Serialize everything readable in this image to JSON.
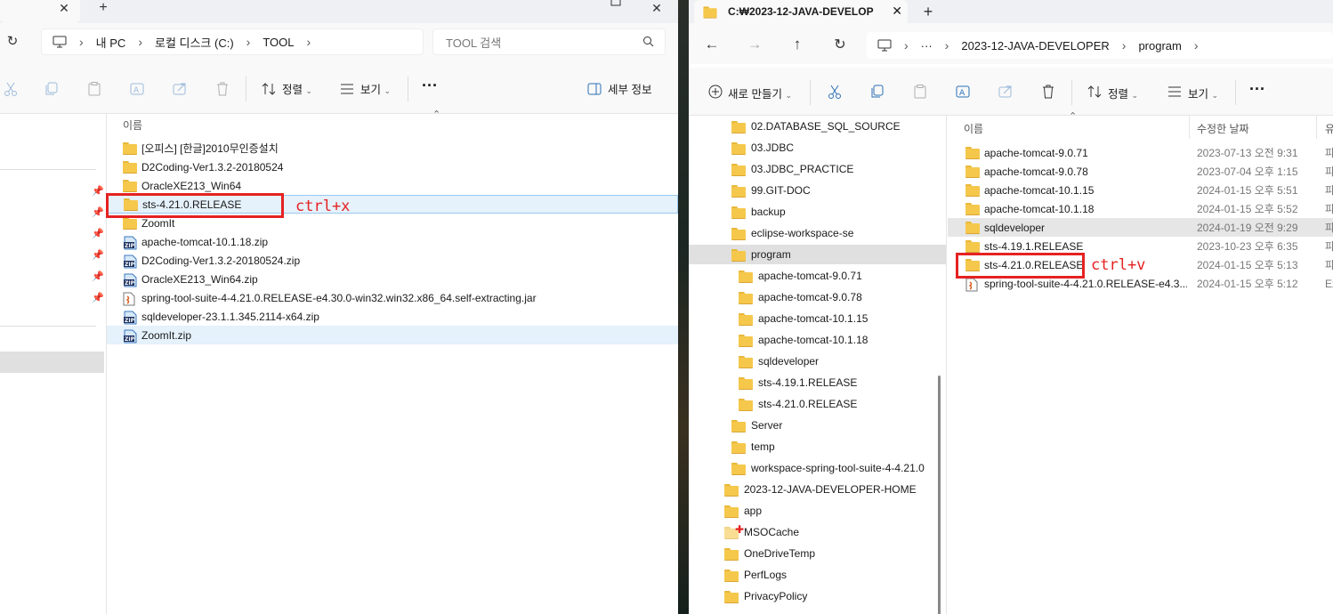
{
  "left": {
    "breadcrumb": [
      "내 PC",
      "로컬 디스크 (C:)",
      "TOOL"
    ],
    "search_placeholder": "TOOL 검색",
    "toolbar": {
      "sort_label": "정렬",
      "view_label": "보기",
      "more_label": "···",
      "details_label": "세부 정보"
    },
    "column_name": "이름",
    "files": [
      {
        "name": "[오피스] [한글]2010무인증설치",
        "type": "folder"
      },
      {
        "name": "D2Coding-Ver1.3.2-20180524",
        "type": "folder"
      },
      {
        "name": "OracleXE213_Win64",
        "type": "folder"
      },
      {
        "name": "sts-4.21.0.RELEASE",
        "type": "folder"
      },
      {
        "name": "ZoomIt",
        "type": "folder"
      },
      {
        "name": "apache-tomcat-10.1.18.zip",
        "type": "zip"
      },
      {
        "name": "D2Coding-Ver1.3.2-20180524.zip",
        "type": "zip"
      },
      {
        "name": "OracleXE213_Win64.zip",
        "type": "zip"
      },
      {
        "name": "spring-tool-suite-4-4.21.0.RELEASE-e4.30.0-win32.win32.x86_64.self-extracting.jar",
        "type": "jar"
      },
      {
        "name": "sqldeveloper-23.1.1.345.2114-x64.zip",
        "type": "zip"
      },
      {
        "name": "ZoomIt.zip",
        "type": "zip"
      }
    ],
    "annotation": "ctrl+x"
  },
  "right": {
    "tab_title": "C:₩2023-12-JAVA-DEVELOPE",
    "breadcrumb": [
      "···",
      "2023-12-JAVA-DEVELOPER",
      "program"
    ],
    "toolbar": {
      "new_label": "새로 만들기",
      "sort_label": "정렬",
      "view_label": "보기",
      "more_label": "···"
    },
    "columns": {
      "name": "이름",
      "modified": "수정한 날짜",
      "type": "유"
    },
    "nav_items": [
      {
        "name": "02.DATABASE_SQL_SOURCE",
        "level": 1
      },
      {
        "name": "03.JDBC",
        "level": 1
      },
      {
        "name": "03.JDBC_PRACTICE",
        "level": 1
      },
      {
        "name": "99.GIT-DOC",
        "level": 1
      },
      {
        "name": "backup",
        "level": 1
      },
      {
        "name": "eclipse-workspace-se",
        "level": 1
      },
      {
        "name": "program",
        "level": 1
      },
      {
        "name": "apache-tomcat-9.0.71",
        "level": 2
      },
      {
        "name": "apache-tomcat-9.0.78",
        "level": 2
      },
      {
        "name": "apache-tomcat-10.1.15",
        "level": 2
      },
      {
        "name": "apache-tomcat-10.1.18",
        "level": 2
      },
      {
        "name": "sqldeveloper",
        "level": 2
      },
      {
        "name": "sts-4.19.1.RELEASE",
        "level": 2
      },
      {
        "name": "sts-4.21.0.RELEASE",
        "level": 2
      },
      {
        "name": "Server",
        "level": 1
      },
      {
        "name": "temp",
        "level": 1
      },
      {
        "name": "workspace-spring-tool-suite-4-4.21.0",
        "level": 1
      },
      {
        "name": "2023-12-JAVA-DEVELOPER-HOME",
        "level": 0
      },
      {
        "name": "app",
        "level": 0
      },
      {
        "name": "MSOCache",
        "level": 0
      },
      {
        "name": "OneDriveTemp",
        "level": 0
      },
      {
        "name": "PerfLogs",
        "level": 0
      },
      {
        "name": "PrivacyPolicy",
        "level": 0
      }
    ],
    "files": [
      {
        "name": "apache-tomcat-9.0.71",
        "date": "2023-07-13 오전 9:31",
        "type": "파"
      },
      {
        "name": "apache-tomcat-9.0.78",
        "date": "2023-07-04 오후 1:15",
        "type": "파"
      },
      {
        "name": "apache-tomcat-10.1.15",
        "date": "2024-01-15 오후 5:51",
        "type": "파"
      },
      {
        "name": "apache-tomcat-10.1.18",
        "date": "2024-01-15 오후 5:52",
        "type": "파"
      },
      {
        "name": "sqldeveloper",
        "date": "2024-01-19 오전 9:29",
        "type": "파"
      },
      {
        "name": "sts-4.19.1.RELEASE",
        "date": "2023-10-23 오후 6:35",
        "type": "파"
      },
      {
        "name": "sts-4.21.0.RELEASE",
        "date": "2024-01-15 오후 5:13",
        "type": "파"
      },
      {
        "name": "spring-tool-suite-4-4.21.0.RELEASE-e4.3...",
        "date": "2024-01-15 오후 5:12",
        "type": "Ex"
      }
    ],
    "annotation": "ctrl+v"
  },
  "colors": {
    "annotation_red": "#e52222",
    "folder_yellow": "#f5c84c",
    "selection_blue": "#cce4f7"
  }
}
